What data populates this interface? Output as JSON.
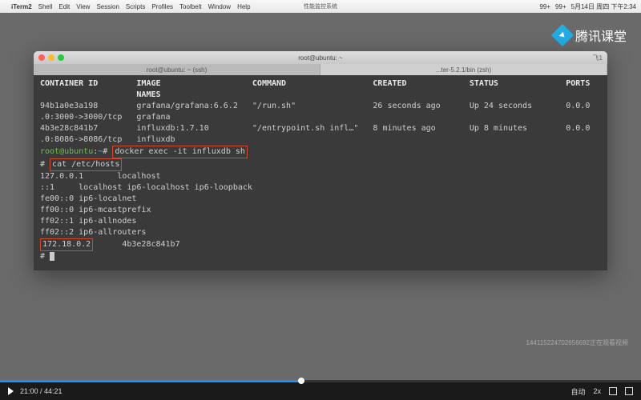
{
  "menubar": {
    "app": "iTerm2",
    "items": [
      "Shell",
      "Edit",
      "View",
      "Session",
      "Scripts",
      "Profiles",
      "Toolbelt",
      "Window",
      "Help"
    ],
    "title_center": "性能监控系统",
    "right_items": [
      "99+",
      "99+",
      "5月14日 周四 下午2:34"
    ]
  },
  "watermark": {
    "text": "腾讯课堂"
  },
  "terminal": {
    "window_title": "root@ubuntu: ~",
    "corner": "飞1",
    "tabs": [
      {
        "label": "root@ubuntu: ~ (ssh)",
        "active": true
      },
      {
        "label": "...ter-5.2.1/bin (zsh)",
        "active": false
      }
    ],
    "header_line1": "CONTAINER ID        IMAGE                   COMMAND                  CREATED             STATUS              PORTS",
    "header_line2": "                    NAMES",
    "rows": [
      "94b1a0e3a198        grafana/grafana:6.6.2   \"/run.sh\"                26 seconds ago      Up 24 seconds       0.0.0",
      ".0:3000->3000/tcp   grafana",
      "4b3e28c841b7        influxdb:1.7.10         \"/entrypoint.sh infl…\"   8 minutes ago       Up 8 minutes        0.0.0",
      ".0:8086->8086/tcp   influxdb"
    ],
    "prompt_user": "root@ubuntu",
    "prompt_path": "~",
    "prompt_sep": "#",
    "cmd_exec": "docker exec -it influxdb sh",
    "cmd_cat_prefix": "# ",
    "cmd_cat": "cat /etc/hosts",
    "hosts": [
      "127.0.0.1       localhost",
      "::1     localhost ip6-localhost ip6-loopback",
      "fe00::0 ip6-localnet",
      "ff00::0 ip6-mcastprefix",
      "ff02::1 ip6-allnodes",
      "ff02::2 ip6-allrouters"
    ],
    "highlight_ip": "172.18.0.2",
    "highlight_rest": "      4b3e28c841b7",
    "final_prompt": "# "
  },
  "viewers": {
    "text": "144115224702656692正在观看视频"
  },
  "player": {
    "time": "21:00 / 44:21",
    "auto": "自动",
    "speed": "2x"
  }
}
